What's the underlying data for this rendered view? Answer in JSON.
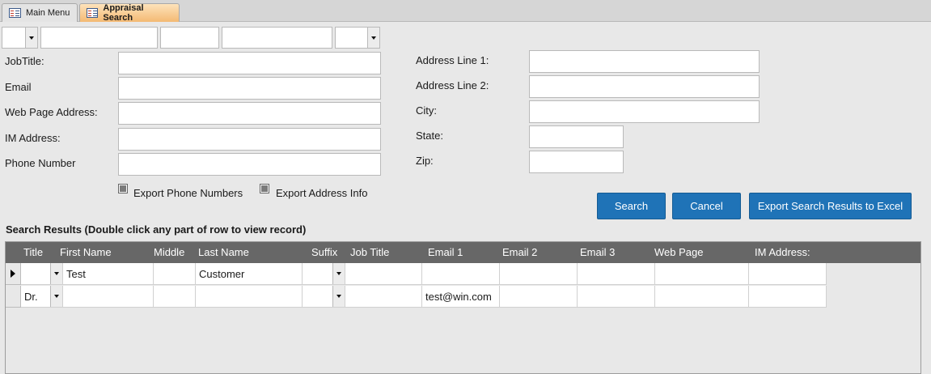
{
  "tabs": [
    {
      "label": "Main Menu",
      "active": false
    },
    {
      "label": "Appraisal Search",
      "active": true
    }
  ],
  "filters": {
    "combo1": "",
    "field1": "",
    "field2": "",
    "field3": "",
    "combo2": ""
  },
  "form": {
    "left_labels": {
      "job_title": "JobTitle:",
      "email": "Email",
      "web_page": "Web Page Address:",
      "im_address": "IM Address:",
      "phone": "Phone Number"
    },
    "right_labels": {
      "address1": "Address Line 1:",
      "address2": "Address Line 2:",
      "city": "City:",
      "state": "State:",
      "zip": "Zip:"
    }
  },
  "checkboxes": {
    "export_phone": "Export Phone Numbers",
    "export_address": "Export Address Info"
  },
  "buttons": {
    "search": "Search",
    "cancel": "Cancel",
    "export": "Export Search Results to Excel"
  },
  "results": {
    "title": "Search Results (Double click any part of row to view record)",
    "columns": [
      "Title",
      "First Name",
      "Middle",
      "Last Name",
      "Suffix",
      "Job Title",
      "Email 1",
      "Email 2",
      "Email 3",
      "Web Page",
      "IM Address:"
    ],
    "rows": [
      {
        "title": "",
        "first_name": "Test",
        "middle": "",
        "last_name": "Customer",
        "suffix": "",
        "job_title": "",
        "email1": "",
        "email2": "",
        "email3": "",
        "web_page": "",
        "im_address": ""
      },
      {
        "title": "Dr.",
        "first_name": "",
        "middle": "",
        "last_name": "",
        "suffix": "",
        "job_title": "",
        "email1": "test@win.com",
        "email2": "",
        "email3": "",
        "web_page": "",
        "im_address": ""
      }
    ]
  },
  "colors": {
    "button": "#1f73b7",
    "grid_header": "#676767",
    "active_tab": "#f4b973"
  }
}
